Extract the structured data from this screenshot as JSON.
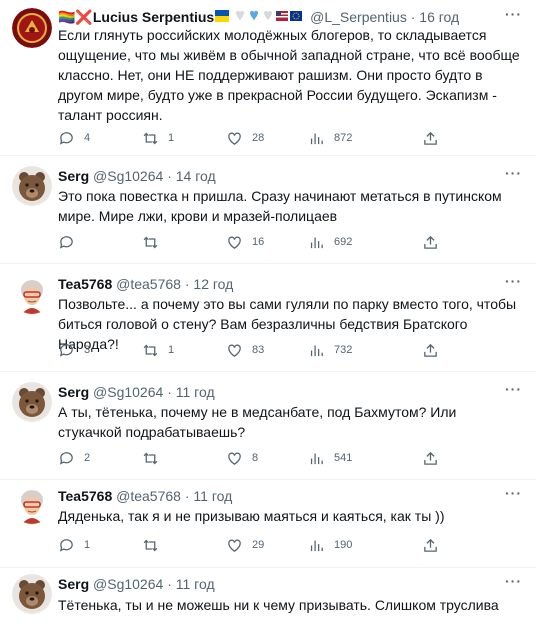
{
  "tweets": [
    {
      "name": "🏳️‍🌈❌Lucius Serpentius",
      "handle": "@L_Serpentius",
      "time": "16 год",
      "text": "Если глянуть российских молодёжных блогеров, то складывается ощущение, что мы живём в обычной западной стране, что всё вообще классно. Нет, они НЕ поддерживают рашизм. Они просто будто в другом мире, будто уже в прекрасной России будущего. Эскапизм - талант россиян.",
      "replies": "4",
      "retweets": "1",
      "likes": "28",
      "views": "872"
    },
    {
      "name": "Serg",
      "handle": "@Sg10264",
      "time": "14 год",
      "text": "Это пока повестка н пришла. Сразу начинают метаться в путинском мире. Мире лжи, крови и мразей-полицаев",
      "replies": "",
      "retweets": "",
      "likes": "16",
      "views": "692"
    },
    {
      "name": "Tea5768",
      "handle": "@tea5768",
      "time": "12 год",
      "text": "Позвольте... а почему это вы сами гуляли по парку вместо того, чтобы биться головой о стену? Вам безразличны бедствия Братского Народа?!",
      "replies": "3",
      "retweets": "1",
      "likes": "83",
      "views": "732"
    },
    {
      "name": "Serg",
      "handle": "@Sg10264",
      "time": "11 год",
      "text": "А ты,  тётенька, почему не в медсанбате, под Бахмутом? Или стукачкой подрабатываешь?",
      "replies": "2",
      "retweets": "",
      "likes": "8",
      "views": "541"
    },
    {
      "name": "Tea5768",
      "handle": "@tea5768",
      "time": "11 год",
      "text": "Дяденька, так я и не призываю маяться и каяться, как ты ))",
      "replies": "1",
      "retweets": "",
      "likes": "29",
      "views": "190"
    },
    {
      "name": "Serg",
      "handle": "@Sg10264",
      "time": "11 год",
      "text": "Тётенька, ты и не можешь ни к чему призывать. Слишком труслива",
      "replies": "",
      "retweets": "",
      "likes": "",
      "views": ""
    }
  ],
  "ui": {
    "dot": "·",
    "more": "···"
  },
  "colors": {
    "text": "#0f1419",
    "muted": "#536471",
    "divider": "#eff3f4"
  }
}
